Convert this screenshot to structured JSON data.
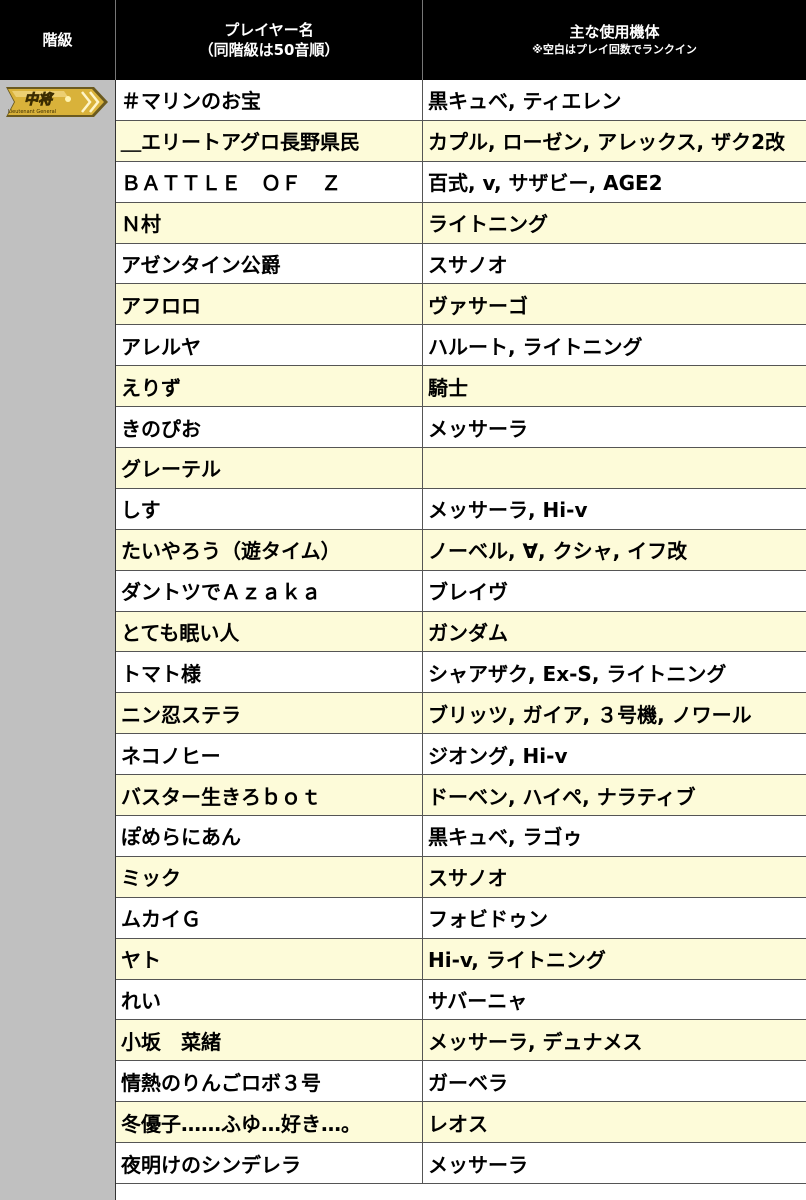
{
  "header": {
    "rank": "階級",
    "player": "プレイヤー名",
    "player_sub": "（同階級は50音順）",
    "units": "主な使用機体",
    "units_note": "※空白はプレイ回数でランクイン"
  },
  "rank_badge": {
    "label": "中将",
    "sub": "Lieutenant General"
  },
  "colors": {
    "header_bg": "#000000",
    "rank_col": "#c0c0c0",
    "alt_row": "#fdfbd9",
    "badge_gold": "#d9b23a"
  },
  "rows": [
    {
      "player": "＃マリンのお宝",
      "units": "黒キュベ, ティエレン"
    },
    {
      "player": "＿エリートアグロ長野県民",
      "units": "カプル, ローゼン, アレックス, ザク2改"
    },
    {
      "player": "ＢＡＴＴＬＥ　ＯＦ　Ｚ",
      "units": "百式, v, サザビー, AGE2"
    },
    {
      "player": "Ｎ村",
      "units": "ライトニング"
    },
    {
      "player": "アゼンタイン公爵",
      "units": "スサノオ"
    },
    {
      "player": "アフロロ",
      "units": "ヴァサーゴ"
    },
    {
      "player": "アレルヤ",
      "units": "ハルート, ライトニング"
    },
    {
      "player": "えりず",
      "units": "騎士"
    },
    {
      "player": "きのぴお",
      "units": "メッサーラ"
    },
    {
      "player": "グレーテル",
      "units": ""
    },
    {
      "player": "しす",
      "units": "メッサーラ, Hi-v"
    },
    {
      "player": "たいやろう（遊タイム）",
      "units": "ノーベル, ∀, クシャ, イフ改"
    },
    {
      "player": "ダントツでＡｚａｋａ",
      "units": "ブレイヴ"
    },
    {
      "player": "とても眠い人",
      "units": "ガンダム"
    },
    {
      "player": "トマト様",
      "units": "シャアザク, Ex-S, ライトニング"
    },
    {
      "player": "ニン忍ステラ",
      "units": "ブリッツ, ガイア, ３号機, ノワール"
    },
    {
      "player": "ネコノヒー",
      "units": "ジオング, Hi-v"
    },
    {
      "player": "バスター生きろｂｏｔ",
      "units": "ドーベン, ハイペ, ナラティブ"
    },
    {
      "player": "ぽめらにあん",
      "units": "黒キュベ, ラゴゥ"
    },
    {
      "player": "ミック",
      "units": "スサノオ"
    },
    {
      "player": "ムカイＧ",
      "units": "フォビドゥン"
    },
    {
      "player": "ヤト",
      "units": "Hi-v, ライトニング"
    },
    {
      "player": "れい",
      "units": "サバーニャ"
    },
    {
      "player": "小坂　菜緒",
      "units": "メッサーラ, デュナメス"
    },
    {
      "player": "情熱のりんごロボ３号",
      "units": "ガーベラ"
    },
    {
      "player": "冬優子……ふゆ…好き…。",
      "units": "レオス"
    },
    {
      "player": "夜明けのシンデレラ",
      "units": "メッサーラ"
    }
  ]
}
